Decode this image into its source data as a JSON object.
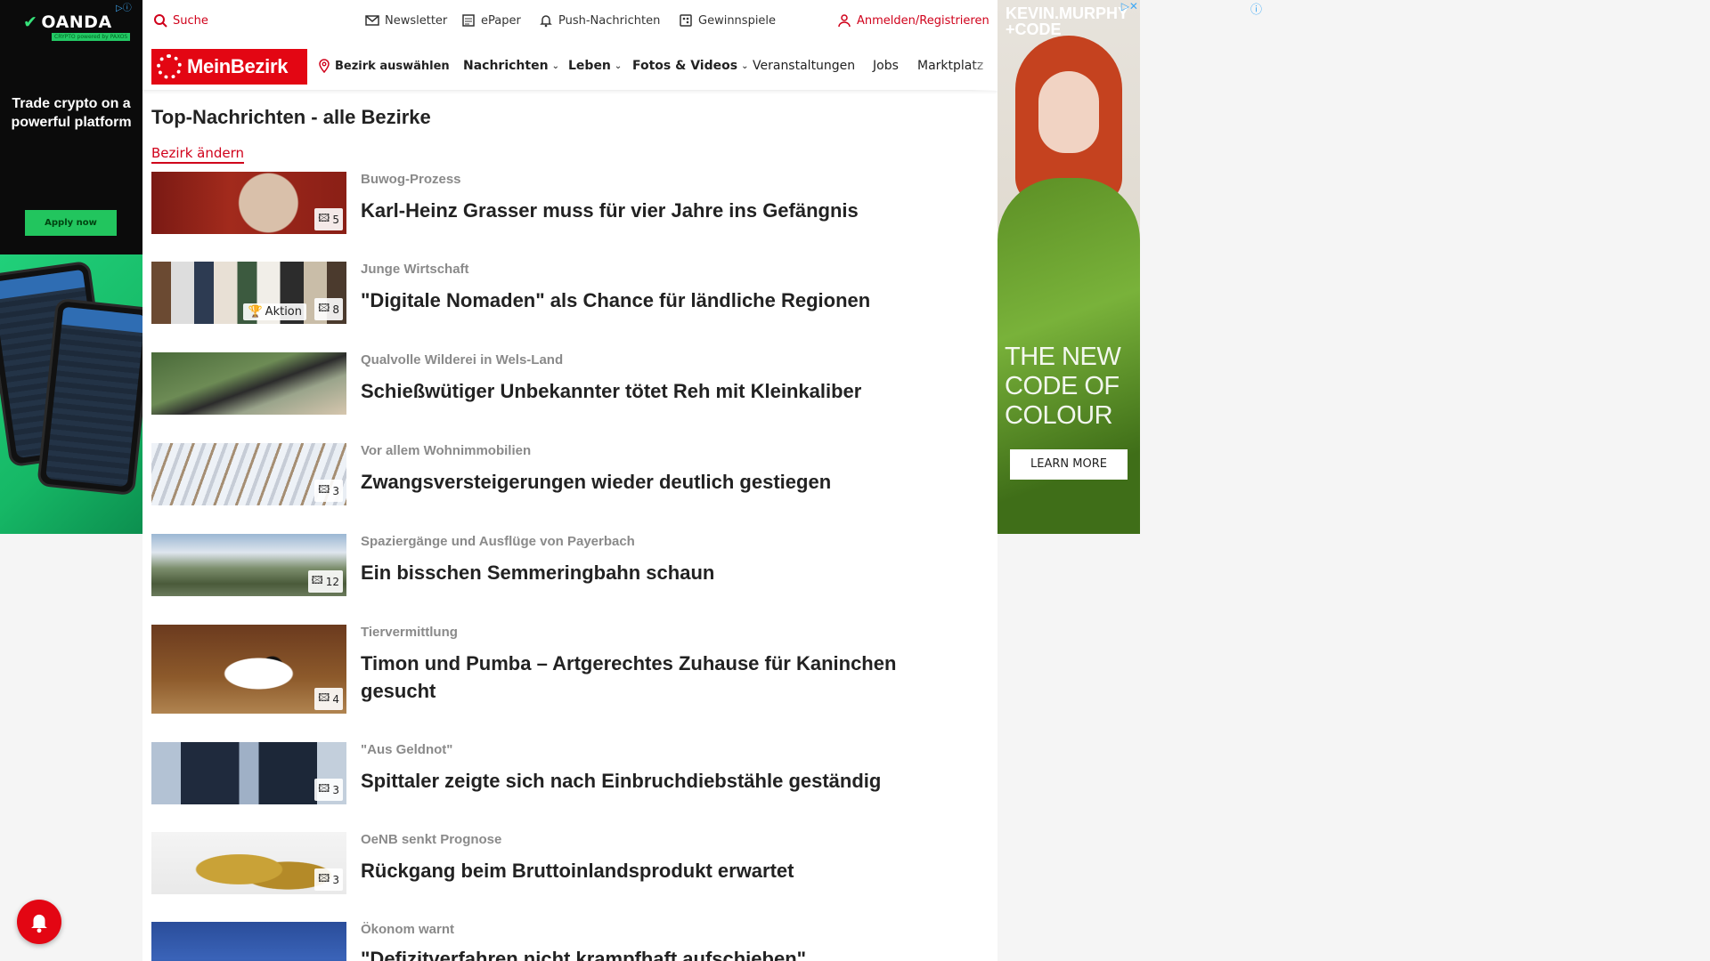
{
  "ad_left": {
    "brand": "OANDA",
    "sub": "CRYPTO powered by PAXOS",
    "headline": "Trade crypto on a powerful platform",
    "cta": "Apply now"
  },
  "topbar": {
    "search": "Suche",
    "newsletter": "Newsletter",
    "epaper": "ePaper",
    "push": "Push-Nachrichten",
    "gewinnspiele": "Gewinnspiele",
    "login": "Anmelden/Registrieren"
  },
  "nav": {
    "logo": "MeinBezirk",
    "bezirk": "Bezirk auswählen",
    "items": [
      {
        "label": "Nachrichten"
      },
      {
        "label": "Leben"
      },
      {
        "label": "Fotos & Videos"
      },
      {
        "label": "Veranstaltungen"
      },
      {
        "label": "Jobs"
      },
      {
        "label": "Marktplatz"
      }
    ]
  },
  "page": {
    "title": "Top-Nachrichten - alle Bezirke",
    "change_link": "Bezirk ändern"
  },
  "articles": [
    {
      "kicker": "Buwog-Prozess",
      "headline": "Karl-Heinz Grasser muss für vier Jahre ins Gefängnis",
      "photos": "5"
    },
    {
      "kicker": "Junge Wirtschaft",
      "headline": "\"Digitale Nomaden\" als Chance für ländliche Regionen",
      "photos": "8",
      "tag": "Aktion"
    },
    {
      "kicker": "Qualvolle Wilderei in Wels-Land",
      "headline": "Schießwütiger Unbekannter tötet Reh mit Kleinkaliber"
    },
    {
      "kicker": "Vor allem Wohnimmobilien",
      "headline": "Zwangsversteigerungen wieder deutlich gestiegen",
      "photos": "3"
    },
    {
      "kicker": "Spaziergänge und Ausflüge von Payerbach",
      "headline": "Ein bisschen Semmeringbahn schaun",
      "photos": "12"
    },
    {
      "kicker": "Tiervermittlung",
      "headline": "Timon und Pumba – Artgerechtes Zuhause für Kaninchen gesucht",
      "photos": "4"
    },
    {
      "kicker": "\"Aus Geldnot\"",
      "headline": "Spittaler zeigte sich nach Einbruchdiebstähle geständig",
      "photos": "3"
    },
    {
      "kicker": "OeNB senkt Prognose",
      "headline": "Rückgang beim Bruttoinlandsprodukt erwartet",
      "photos": "3"
    },
    {
      "kicker": "Ökonom warnt",
      "headline": "\"Defizitverfahren nicht krampfhaft aufschieben\""
    }
  ],
  "ad_right": {
    "brand_line1": "KEVIN.MURPHY",
    "brand_line2": "+CODE",
    "tagline_line1": "THE NEW",
    "tagline_line2": "CODE OF",
    "tagline_line3": "COLOUR",
    "cta": "LEARN MORE"
  },
  "colors": {
    "brand_red": "#e30613",
    "link_red": "#d0021b"
  }
}
